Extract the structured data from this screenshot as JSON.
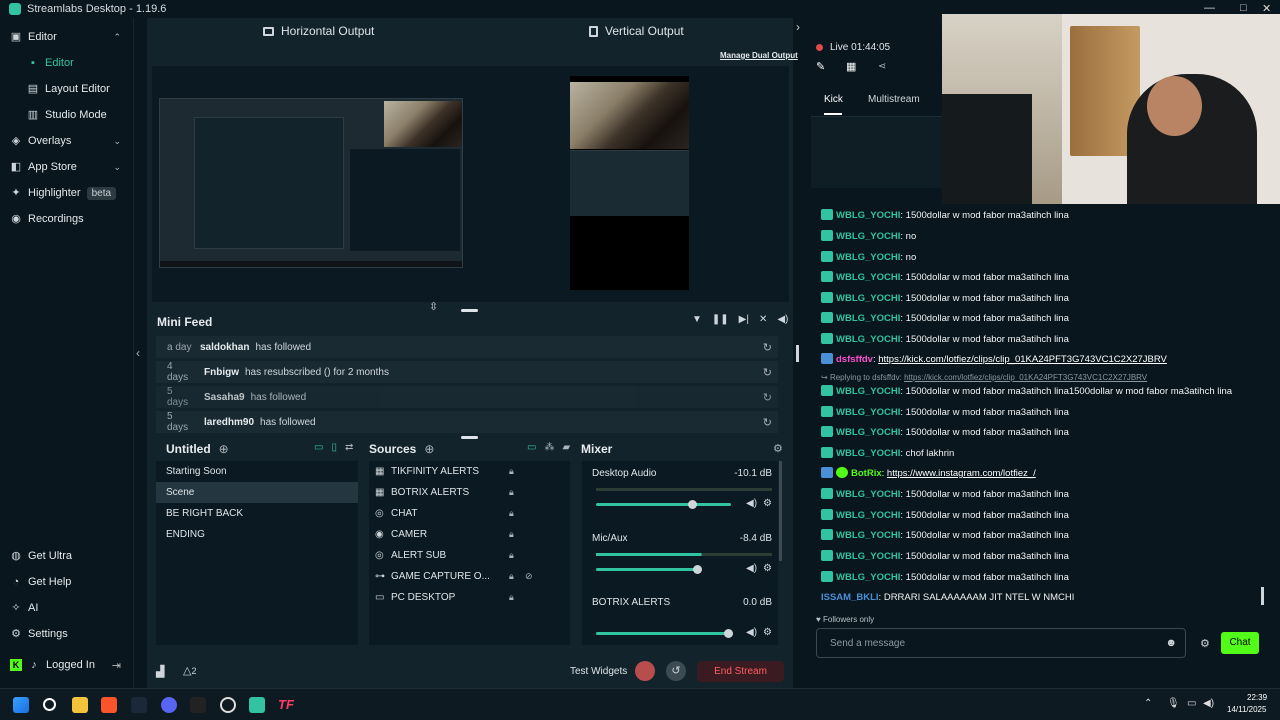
{
  "app": {
    "title": "Streamlabs Desktop - 1.19.6"
  },
  "window_controls": {
    "minimize": "—",
    "maximize": "□",
    "close": "✕"
  },
  "sidebar": {
    "top": [
      {
        "label": "Editor",
        "icon": "editor-icon",
        "chevron": "⌃"
      },
      {
        "label": "Editor",
        "icon": "edit-tab-icon"
      },
      {
        "label": "Layout Editor",
        "icon": "layout-icon"
      },
      {
        "label": "Studio Mode",
        "icon": "studio-icon"
      },
      {
        "label": "Overlays",
        "icon": "overlays-icon",
        "chevron": "⌄"
      },
      {
        "label": "App Store",
        "icon": "store-icon",
        "chevron": "⌄"
      },
      {
        "label": "Highlighter",
        "icon": "highlighter-icon",
        "badge": "beta"
      },
      {
        "label": "Recordings",
        "icon": "recordings-icon"
      }
    ],
    "bottom": [
      {
        "label": "Get Ultra",
        "icon": "ultra-icon"
      },
      {
        "label": "Get Help",
        "icon": "help-icon"
      },
      {
        "label": "AI",
        "icon": "ai-icon"
      },
      {
        "label": "Settings",
        "icon": "settings-icon"
      },
      {
        "label": "Logged In",
        "icon": "kick-logo-icon"
      }
    ]
  },
  "editor": {
    "horizontal_output": "Horizontal Output",
    "vertical_output": "Vertical Output",
    "manage_dual_output": "Manage Dual Output"
  },
  "minifeed": {
    "title": "Mini Feed",
    "rows": [
      {
        "time": "a day",
        "user": "saldokhan",
        "action": "has followed"
      },
      {
        "time": "4 days",
        "user": "Fnbigw",
        "action": "has resubscribed () for 2 months"
      },
      {
        "time": "5 days",
        "user": "Sasaha9",
        "action": "has followed"
      },
      {
        "time": "5 days",
        "user": "laredhm90",
        "action": "has followed"
      }
    ]
  },
  "scenes": {
    "title": "Untitled",
    "items": [
      "Starting Soon",
      "Scene",
      "BE RIGHT BACK",
      "ENDING"
    ],
    "selected": 1
  },
  "sources": {
    "title": "Sources",
    "items": [
      {
        "label": "TIKFINITY ALERTS",
        "icon": "browser-source-icon"
      },
      {
        "label": "BOTRIX ALERTS",
        "icon": "browser-source-icon"
      },
      {
        "label": "CHAT",
        "icon": "browser-source-icon"
      },
      {
        "label": "CAMER",
        "icon": "webcam-icon"
      },
      {
        "label": "ALERT SUB",
        "icon": "browser-source-icon"
      },
      {
        "label": "GAME CAPTURE O...",
        "icon": "gamepad-icon"
      },
      {
        "label": "PC DESKTOP",
        "icon": "monitor-icon"
      }
    ]
  },
  "mixer": {
    "title": "Mixer",
    "channels": [
      {
        "name": "Desktop Audio",
        "db": "-10.1 dB",
        "volume": 0.72
      },
      {
        "name": "Mic/Aux",
        "db": "-8.4 dB",
        "volume": 0.76
      },
      {
        "name": "BOTRIX ALERTS",
        "db": "0.0 dB",
        "volume": 1.0
      }
    ]
  },
  "bottombar": {
    "test_widgets": "Test Widgets",
    "end_stream": "End Stream",
    "alerts_count": "2"
  },
  "live": {
    "status": "Live",
    "timer": "01:44:05"
  },
  "chat_tabs": [
    "Kick",
    "Multistream"
  ],
  "chat": {
    "messages": [
      {
        "user": "WBLG_YOCHI",
        "text": "1500dollar w mod fabor ma3atihch lina"
      },
      {
        "user": "WBLG_YOCHI",
        "text": "no"
      },
      {
        "user": "WBLG_YOCHI",
        "text": "no"
      },
      {
        "user": "WBLG_YOCHI",
        "text": "1500dollar w mod fabor ma3atihch lina"
      },
      {
        "user": "WBLG_YOCHI",
        "text": "1500dollar w mod fabor ma3atihch lina"
      },
      {
        "user": "WBLG_YOCHI",
        "text": "1500dollar w mod fabor ma3atihch lina"
      },
      {
        "user": "WBLG_YOCHI",
        "text": "1500dollar w mod fabor ma3atihch lina"
      }
    ],
    "dsfs": {
      "user": "dsfsffdv",
      "link": "https://kick.com/lotfiez/clips/clip_01KA24PFT3G743VC1C2X27JBRV"
    },
    "reply": {
      "prefix": "Replying to dsfsffdv:",
      "link": "https://kick.com/lotfiez/clips/clip_01KA24PFT3G743VC1C2X27JBRV"
    },
    "messages2": [
      {
        "user": "WBLG_YOCHI",
        "text": "1500dollar w mod fabor ma3atihch lina1500dollar w mod fabor ma3atihch lina"
      },
      {
        "user": "WBLG_YOCHI",
        "text": "1500dollar w mod fabor ma3atihch lina"
      },
      {
        "user": "WBLG_YOCHI",
        "text": "1500dollar w mod fabor ma3atihch lina"
      },
      {
        "user": "WBLG_YOCHI",
        "text": "chof lakhrin"
      }
    ],
    "botrix": {
      "user": "BotRix",
      "link": "https://www.instagram.com/lotfiez_/"
    },
    "messages3": [
      {
        "user": "WBLG_YOCHI",
        "text": "1500dollar w mod fabor ma3atihch lina"
      },
      {
        "user": "WBLG_YOCHI",
        "text": "1500dollar w mod fabor ma3atihch lina"
      },
      {
        "user": "WBLG_YOCHI",
        "text": "1500dollar w mod fabor ma3atihch lina"
      },
      {
        "user": "WBLG_YOCHI",
        "text": "1500dollar w mod fabor ma3atihch lina"
      },
      {
        "user": "WBLG_YOCHI",
        "text": "1500dollar w mod fabor ma3atihch lina"
      }
    ],
    "last": {
      "user": "ISSAM_BKLI",
      "text": "DRRARI SALAAAAAAM JIT NTEL W NMCHI"
    },
    "followers_only": "Followers only",
    "input_placeholder": "Send a message",
    "send": "Chat"
  },
  "taskbar": {
    "time": "22:39",
    "date": "14/11/2025"
  },
  "colors": {
    "accent": "#31c3a2",
    "end_stream": "#e04a4a",
    "chat_button": "#53fc18"
  }
}
